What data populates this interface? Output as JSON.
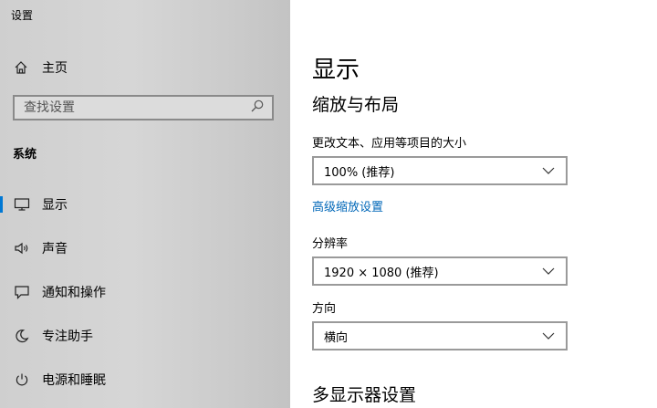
{
  "window": {
    "title": "设置"
  },
  "sidebar": {
    "home_label": "主页",
    "search_placeholder": "查找设置",
    "section_label": "系统",
    "items": [
      {
        "label": "显示",
        "icon": "monitor-icon",
        "active": true
      },
      {
        "label": "声音",
        "icon": "speaker-icon",
        "active": false
      },
      {
        "label": "通知和操作",
        "icon": "notification-icon",
        "active": false
      },
      {
        "label": "专注助手",
        "icon": "moon-icon",
        "active": false
      },
      {
        "label": "电源和睡眠",
        "icon": "power-icon",
        "active": false
      }
    ]
  },
  "main": {
    "title": "显示",
    "scale_section": "缩放与布局",
    "text_size_label": "更改文本、应用等项目的大小",
    "text_size_value": "100% (推荐)",
    "advanced_scaling_link": "高级缩放设置",
    "resolution_label": "分辨率",
    "resolution_value": "1920 × 1080 (推荐)",
    "orientation_label": "方向",
    "orientation_value": "横向",
    "multi_display_section": "多显示器设置"
  },
  "colors": {
    "accent": "#0078d4",
    "link": "#0067b8"
  }
}
